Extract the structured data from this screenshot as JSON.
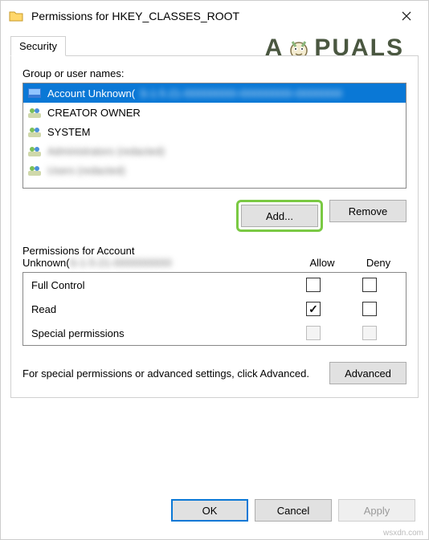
{
  "title": "Permissions for HKEY_CLASSES_ROOT",
  "tab": "Security",
  "groups_label": "Group or user names:",
  "list": [
    {
      "label": "Account Unknown(",
      "selected": true,
      "icon": "user"
    },
    {
      "label": "CREATOR OWNER",
      "selected": false,
      "icon": "group"
    },
    {
      "label": "SYSTEM",
      "selected": false,
      "icon": "group"
    },
    {
      "label": "Administrators (redacted)",
      "selected": false,
      "icon": "group",
      "blur": true
    },
    {
      "label": "Users (redacted)",
      "selected": false,
      "icon": "group",
      "blur": true
    }
  ],
  "buttons": {
    "add": "Add...",
    "remove": "Remove",
    "ok": "OK",
    "cancel": "Cancel",
    "apply": "Apply",
    "advanced": "Advanced"
  },
  "perm_header": {
    "label_prefix": "Permissions for Account",
    "label_line2": "Unknown(",
    "allow": "Allow",
    "deny": "Deny"
  },
  "perms": [
    {
      "name": "Full Control",
      "allow": false,
      "deny": false,
      "disabled": false
    },
    {
      "name": "Read",
      "allow": true,
      "deny": false,
      "disabled": false
    },
    {
      "name": "Special permissions",
      "allow": false,
      "deny": false,
      "disabled": true
    }
  ],
  "advanced_text": "For special permissions or advanced settings, click Advanced.",
  "watermark": "A   PUALS",
  "source_tag": "wsxdn.com"
}
